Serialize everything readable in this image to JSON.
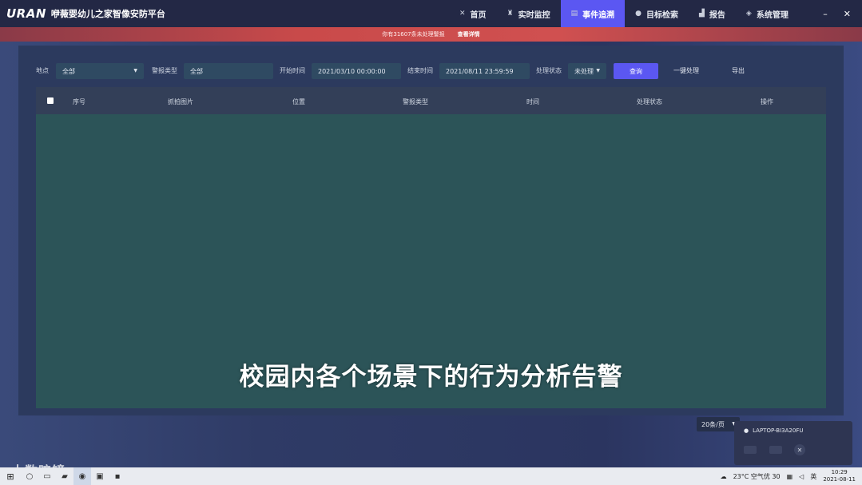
{
  "app": {
    "logo": "URAN",
    "title": "咿薇婴幼儿之家智像安防平台"
  },
  "nav": {
    "items": [
      {
        "label": "首页",
        "icon": "home-icon",
        "glyph": "✕"
      },
      {
        "label": "实时监控",
        "icon": "camera-icon",
        "glyph": "♜"
      },
      {
        "label": "事件追溯",
        "icon": "document-icon",
        "glyph": "▤"
      },
      {
        "label": "目标检索",
        "icon": "person-icon",
        "glyph": "●"
      },
      {
        "label": "报告",
        "icon": "chart-icon",
        "glyph": "▟"
      },
      {
        "label": "系统管理",
        "icon": "layers-icon",
        "glyph": "◈"
      }
    ],
    "active_index": 2
  },
  "window": {
    "minimize": "–",
    "close": "✕"
  },
  "alert": {
    "message": "你有31607条未处理警报",
    "link": "查看详情"
  },
  "filters": {
    "location_label": "地点",
    "location_value": "全部",
    "alarm_type_label": "警报类型",
    "alarm_type_value": "全部",
    "start_label": "开始时间",
    "start_value": "2021/03/10 00:00:00",
    "end_label": "结束时间",
    "end_value": "2021/08/11 23:59:59",
    "status_label": "处理状态",
    "status_value": "未处理",
    "query_button": "查询",
    "batch_button": "一键处理",
    "export_button": "导出"
  },
  "table": {
    "columns": [
      "序号",
      "抓拍图片",
      "位置",
      "警报类型",
      "时间",
      "处理状态",
      "操作"
    ],
    "rows": []
  },
  "subtitle": "校园内各个场景下的行为分析告警",
  "pagination": {
    "page_size": "20条/页"
  },
  "device": {
    "name": "LAPTOP-BI3A20FU"
  },
  "watermark": "大数暗镜",
  "taskbar": {
    "weather": "23°C 空气优 30",
    "ime": "英",
    "time": "10:29",
    "date": "2021-08-11"
  },
  "colors": {
    "accent": "#5b57f2",
    "alert": "#c94a4a",
    "panel": "#2c3a5e",
    "table_body": "#2c5458"
  }
}
